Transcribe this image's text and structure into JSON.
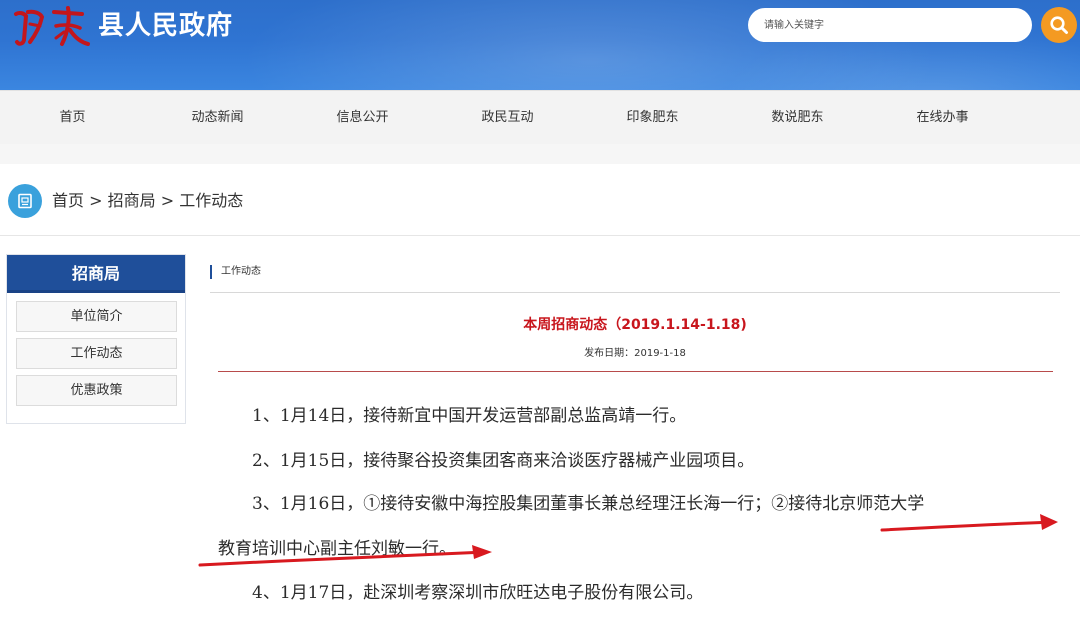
{
  "header": {
    "logo_text": "肥东",
    "site_title": "县人民政府",
    "search_placeholder": "请输入关键字"
  },
  "nav": [
    "首页",
    "动态新闻",
    "信息公开",
    "政民互动",
    "印象肥东",
    "数说肥东",
    "在线办事"
  ],
  "breadcrumb": {
    "home": "首页",
    "sep": " > ",
    "level1": "招商局",
    "level2": "工作动态"
  },
  "sidebar": {
    "title": "招商局",
    "items": [
      "单位简介",
      "工作动态",
      "优惠政策"
    ]
  },
  "article": {
    "section_label": "工作动态",
    "title": "本周招商动态（2019.1.14-1.18)",
    "date_label": "发布日期：",
    "date_value": "2019-1-18",
    "paragraphs": [
      "1、1月14日，接待新宜中国开发运营部副总监高靖一行。",
      "2、1月15日，接待聚谷投资集团客商来洽谈医疗器械产业园项目。",
      "3、1月16日，①接待安徽中海控股集团董事长兼总经理汪长海一行；②接待北京师范大学",
      "教育培训中心副主任刘敏一行。",
      "4、1月17日，赴深圳考察深圳市欣旺达电子股份有限公司。"
    ]
  },
  "colors": {
    "header_blue": "#2f74d2",
    "sidebar_blue": "#1f4f9a",
    "search_orange": "#f49a22",
    "title_red": "#c8161d",
    "annotation_red": "#d8191f"
  }
}
